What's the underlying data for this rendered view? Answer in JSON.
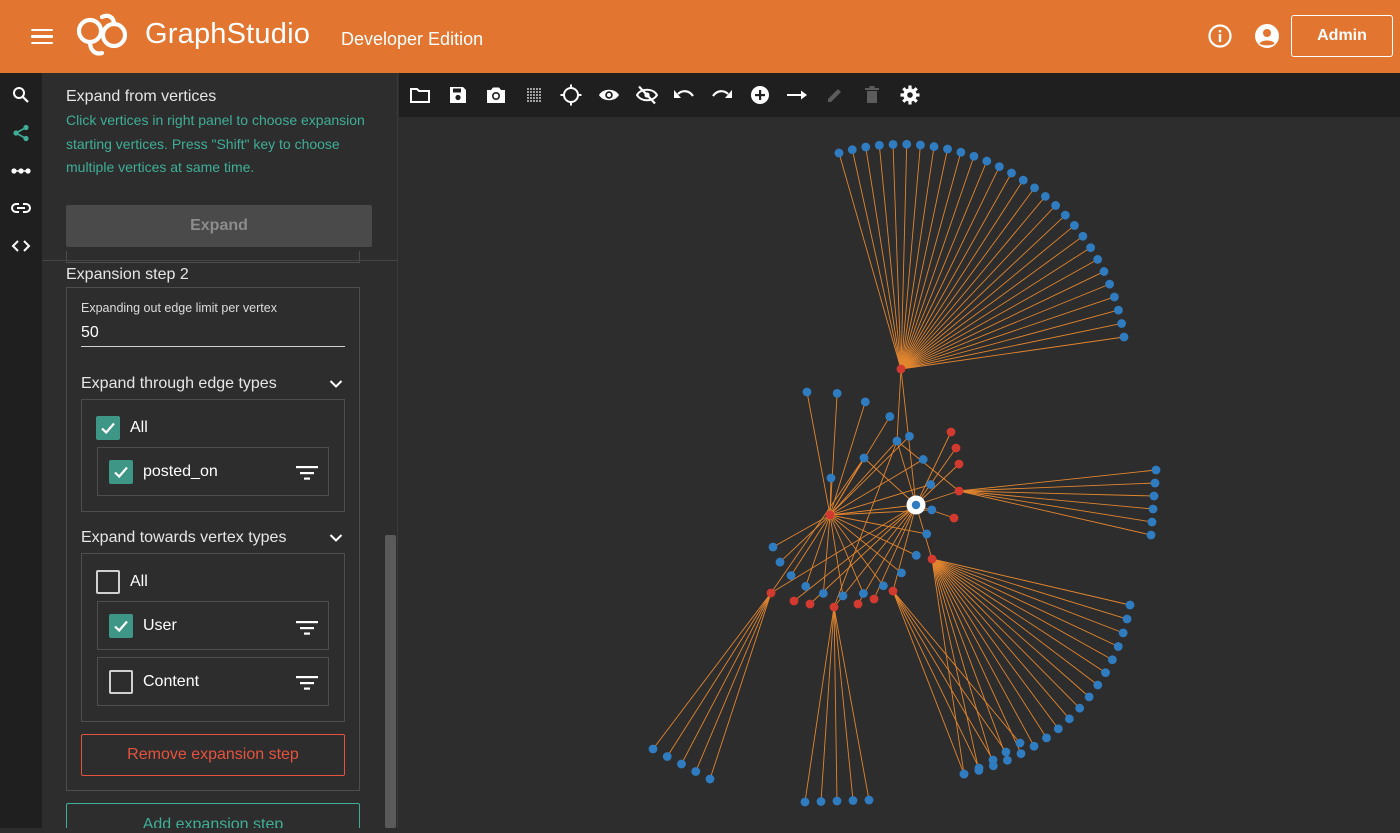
{
  "header": {
    "brand_part1": "Graph",
    "brand_part2": "Studio",
    "edition": "Developer Edition",
    "admin_label": "Admin",
    "accent_color": "#e2752f"
  },
  "rail": {
    "items": [
      "search-icon",
      "share-icon",
      "more-horiz-icon",
      "link-icon",
      "code-icon"
    ],
    "active_item": "share-icon"
  },
  "panel": {
    "title": "Expand from vertices",
    "help_text": "Click vertices in right panel to choose expansion starting vertices. Press \"Shift\" key to choose multiple vertices at same time.",
    "expand_label": "Expand",
    "step_title": "Expansion step 2",
    "limit_label": "Expanding out edge limit per vertex",
    "limit_value": "50",
    "edge_section": {
      "title": "Expand through edge types",
      "all_label": "All",
      "all_checked": true,
      "items": [
        {
          "label": "posted_on",
          "checked": true
        }
      ]
    },
    "vertex_section": {
      "title": "Expand towards vertex types",
      "all_label": "All",
      "all_checked": false,
      "items": [
        {
          "label": "User",
          "checked": true
        },
        {
          "label": "Content",
          "checked": false
        }
      ]
    },
    "remove_label": "Remove expansion step",
    "add_label": "Add expansion step"
  },
  "toolbar": {
    "tools": [
      "folder-icon",
      "save-icon",
      "camera-icon",
      "grid-icon",
      "locate-icon",
      "show-icon",
      "hide-icon",
      "undo-icon",
      "redo-icon",
      "add-vertex-icon",
      "add-edge-icon",
      "edit-icon",
      "delete-icon",
      "settings-icon"
    ],
    "disabled_tools": [
      "edit-icon",
      "delete-icon"
    ]
  },
  "graph": {
    "colors": {
      "user_vertex": "#2f7cc1",
      "content_vertex": "#d23a2f",
      "edge": "#e2852f",
      "selected_ring": "#ffffff"
    },
    "hubs": [
      {
        "id": "h_top",
        "type": "content",
        "leaf_count": 29
      },
      {
        "id": "h_left",
        "type": "content",
        "leaf_count": 19
      },
      {
        "id": "h_right",
        "type": "content",
        "leaf_count": 6
      },
      {
        "id": "h_se",
        "type": "content",
        "leaf_count": 18
      },
      {
        "id": "h_ll",
        "type": "content",
        "leaf_count": 5
      },
      {
        "id": "h_bm",
        "type": "content",
        "leaf_count": 5
      },
      {
        "id": "h_bm2",
        "type": "content",
        "leaf_count": 5
      }
    ],
    "selected_vertex": "center"
  }
}
